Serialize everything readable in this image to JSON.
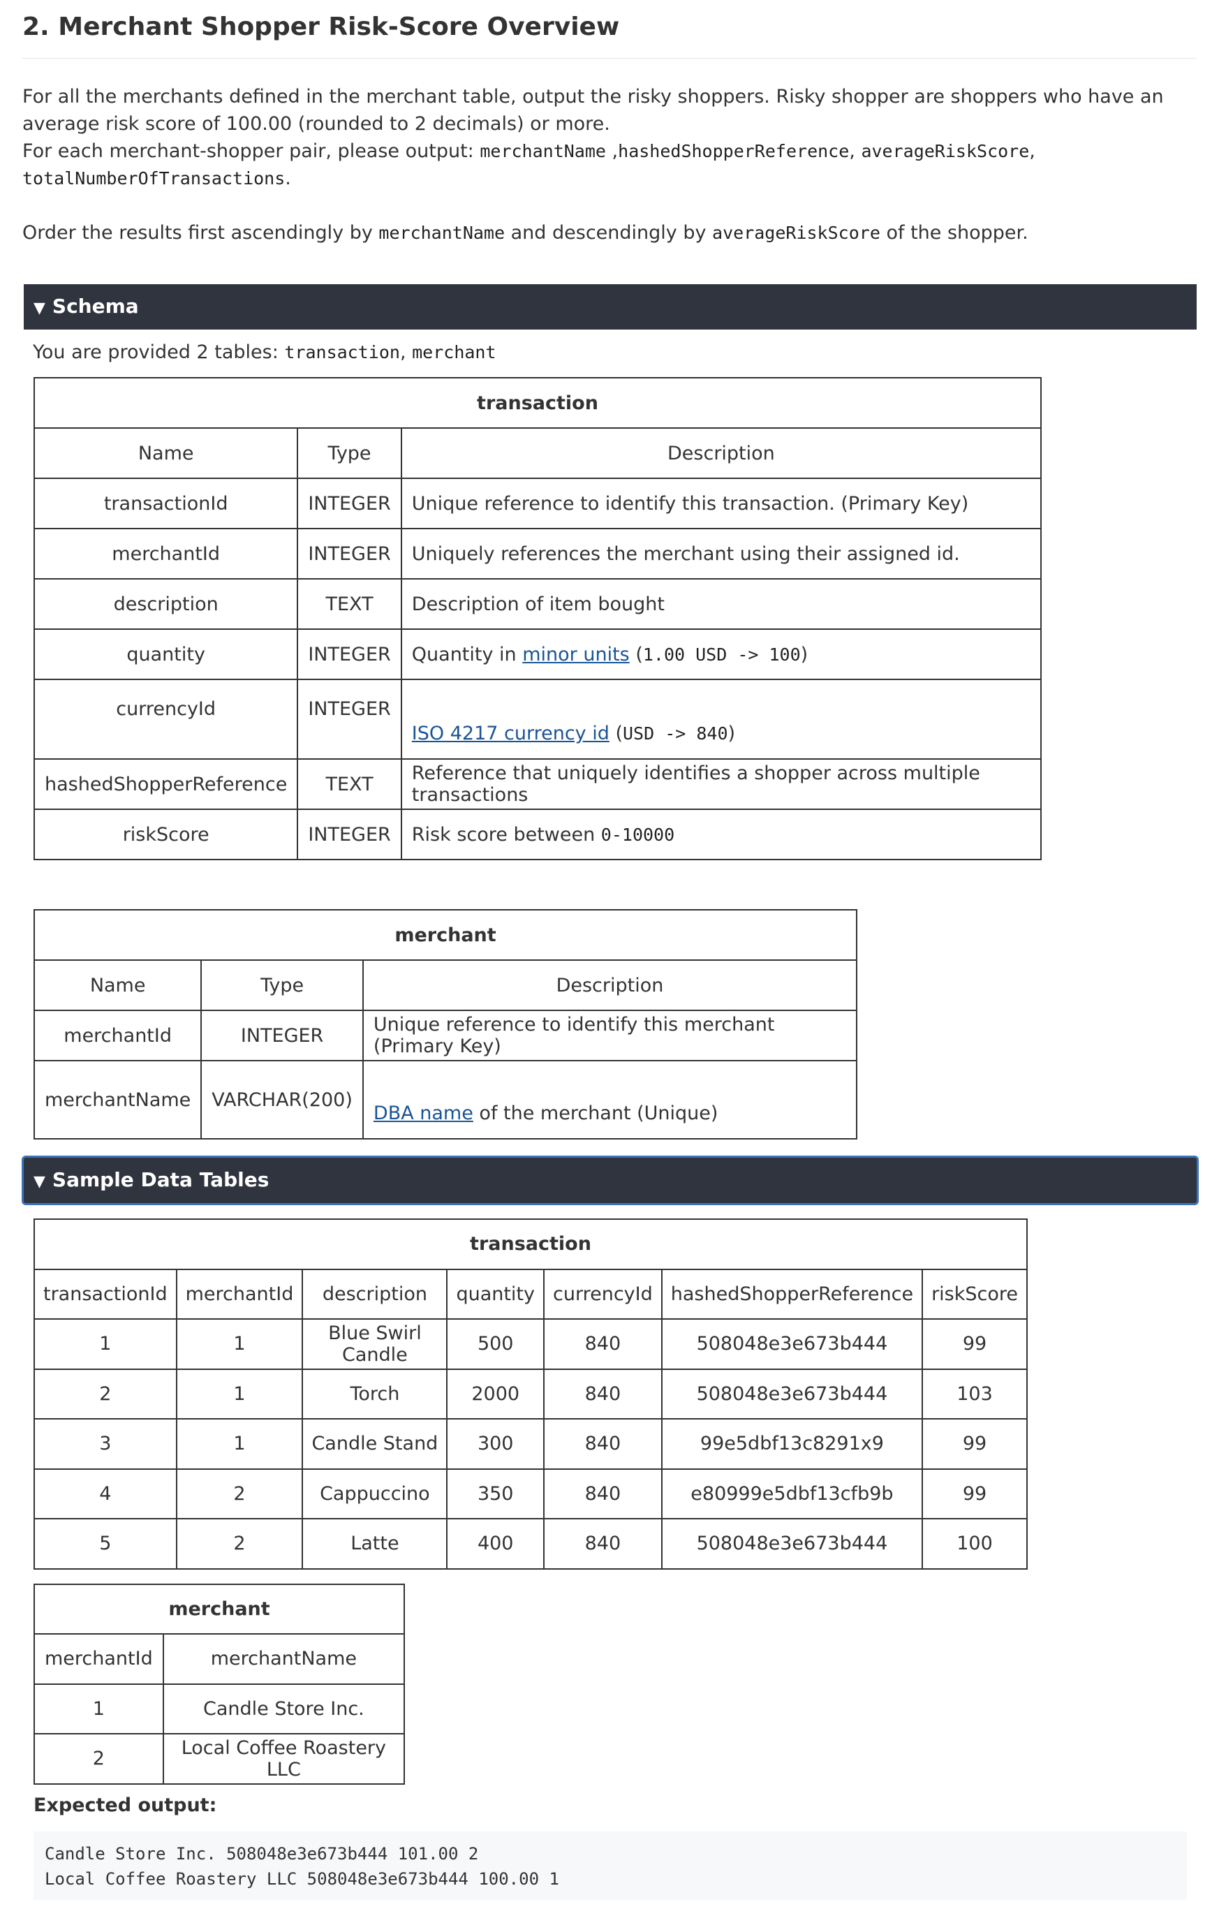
{
  "title": "2. Merchant Shopper Risk-Score Overview",
  "intro": {
    "line1": "For all the merchants defined in the merchant table, output the risky shoppers. Risky shopper are shoppers who have an average risk score of 100.00 (rounded to 2 decimals) or more.",
    "line2_prefix": "For each merchant-shopper pair, please output: ",
    "fields": [
      "merchantName",
      "hashedShopperReference",
      "averageRiskScore",
      "totalNumberOfTransactions"
    ],
    "order_prefix": "Order the results first ascendingly by ",
    "order_field1": "merchantName",
    "order_middle": " and descendingly by ",
    "order_field2": "averageRiskScore",
    "order_suffix": " of the shopper."
  },
  "schema": {
    "header": "Schema",
    "provided_prefix": "You are provided 2 tables: ",
    "tables": [
      "transaction",
      "merchant"
    ],
    "transaction": {
      "caption": "transaction",
      "columns": [
        "Name",
        "Type",
        "Description"
      ],
      "rows": [
        {
          "name": "transactionId",
          "type": "INTEGER",
          "desc": "Unique reference to identify this transaction. (Primary Key)"
        },
        {
          "name": "merchantId",
          "type": "INTEGER",
          "desc": "Uniquely references the merchant using their assigned id."
        },
        {
          "name": "description",
          "type": "TEXT",
          "desc": "Description of item bought"
        },
        {
          "name": "quantity",
          "type": "INTEGER",
          "desc_prefix": "Quantity in ",
          "desc_link": "minor units",
          "desc_code": "1.00 USD -> 100"
        },
        {
          "name": "currencyId",
          "type": "INTEGER",
          "desc_link": "ISO 4217 currency id",
          "desc_code": "USD -> 840"
        },
        {
          "name": "hashedShopperReference",
          "type": "TEXT",
          "desc": "Reference that uniquely identifies a shopper across multiple transactions"
        },
        {
          "name": "riskScore",
          "type": "INTEGER",
          "desc_prefix": "Risk score between ",
          "desc_code": "0-10000"
        }
      ]
    },
    "merchant": {
      "caption": "merchant",
      "columns": [
        "Name",
        "Type",
        "Description"
      ],
      "rows": [
        {
          "name": "merchantId",
          "type": "INTEGER",
          "desc": "Unique reference to identify this merchant (Primary Key)"
        },
        {
          "name": "merchantName",
          "type": "VARCHAR(200)",
          "desc_link": "DBA name",
          "desc_suffix": " of the merchant (Unique)"
        }
      ]
    }
  },
  "sample": {
    "header": "Sample Data Tables",
    "transaction": {
      "caption": "transaction",
      "columns": [
        "transactionId",
        "merchantId",
        "description",
        "quantity",
        "currencyId",
        "hashedShopperReference",
        "riskScore"
      ],
      "rows": [
        [
          "1",
          "1",
          "Blue Swirl Candle",
          "500",
          "840",
          "508048e3e673b444",
          "99"
        ],
        [
          "2",
          "1",
          "Torch",
          "2000",
          "840",
          "508048e3e673b444",
          "103"
        ],
        [
          "3",
          "1",
          "Candle Stand",
          "300",
          "840",
          "99e5dbf13c8291x9",
          "99"
        ],
        [
          "4",
          "2",
          "Cappuccino",
          "350",
          "840",
          "e80999e5dbf13cfb9b",
          "99"
        ],
        [
          "5",
          "2",
          "Latte",
          "400",
          "840",
          "508048e3e673b444",
          "100"
        ]
      ]
    },
    "merchant": {
      "caption": "merchant",
      "columns": [
        "merchantId",
        "merchantName"
      ],
      "rows": [
        [
          "1",
          "Candle Store Inc."
        ],
        [
          "2",
          "Local Coffee Roastery LLC"
        ]
      ]
    },
    "expected_label": "Expected output:",
    "expected_lines": [
      "Candle Store Inc. 508048e3e673b444 101.00 2",
      "Local Coffee Roastery LLC 508048e3e673b444 100.00 1"
    ]
  }
}
